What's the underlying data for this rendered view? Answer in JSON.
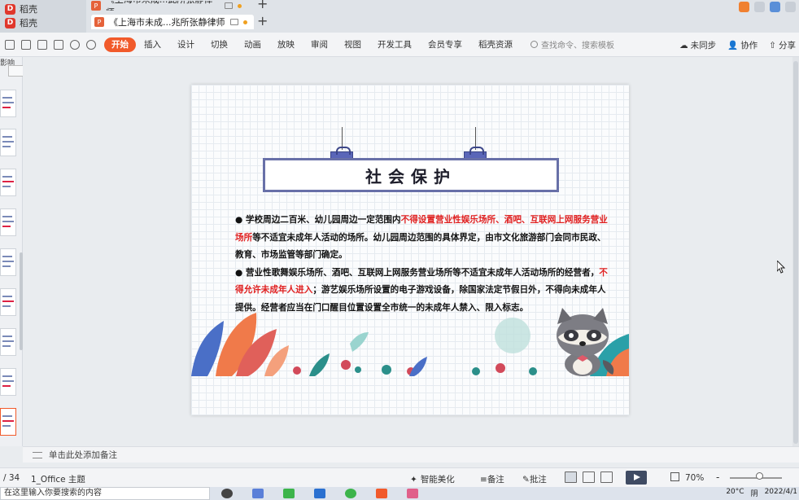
{
  "window_tabs": {
    "side_tabs": [
      "稻壳",
      "稻壳"
    ],
    "file_tabs": [
      "《上海市未成...此所张静律师",
      "《上海市未成...兆所张静律师"
    ],
    "new_tab_symbol": "+"
  },
  "ribbon": {
    "tabs": [
      "开始",
      "插入",
      "设计",
      "切换",
      "动画",
      "放映",
      "审阅",
      "视图",
      "开发工具",
      "会员专享",
      "稻壳资源"
    ],
    "active_tab": "开始",
    "search_placeholder": "查找命令、搜索模板",
    "unsynced": "未同步",
    "collab": "协作",
    "share": "分享"
  },
  "left_panel": {
    "label": "影响",
    "selected_slide": 34
  },
  "slide": {
    "title": "社会保护",
    "p1_prefix": "●  学校周边二百米、幼儿园周边一定范围内",
    "p1_red": "不得设置营业性娱乐场所、酒吧、互联网上网服务营业场所",
    "p1_suffix": "等不适宜未成年人活动的场所。幼儿园周边范围的具体界定，由市文化旅游部门会同市民政、教育、市场监管等部门确定。",
    "p2_prefix": "●  营业性歌舞娱乐场所、酒吧、互联网上网服务营业场所等不适宜未成年人活动场所的经营者，",
    "p2_red": "不得允许未成年人进入",
    "p2_suffix": "；游艺娱乐场所设置的电子游戏设备，除国家法定节假日外，不得向未成年人提供。经营者应当在门口醒目位置设置全市统一的未成年人禁入、限入标志。"
  },
  "notes": {
    "placeholder": "单击此处添加备注"
  },
  "status": {
    "page": "/ 34",
    "theme": "1_Office 主题",
    "beautify": "智能美化",
    "notes": "备注",
    "comment": "批注",
    "zoom": "70%",
    "zoom_minus": "-"
  },
  "taskbar": {
    "search_text": "在这里输入你要搜索的内容",
    "temperature": "20°C",
    "weather": "阴",
    "date": "2022/4/1"
  },
  "colors": {
    "accent": "#f15a2b",
    "title_border": "#6870a8",
    "red_text": "#e02020"
  }
}
